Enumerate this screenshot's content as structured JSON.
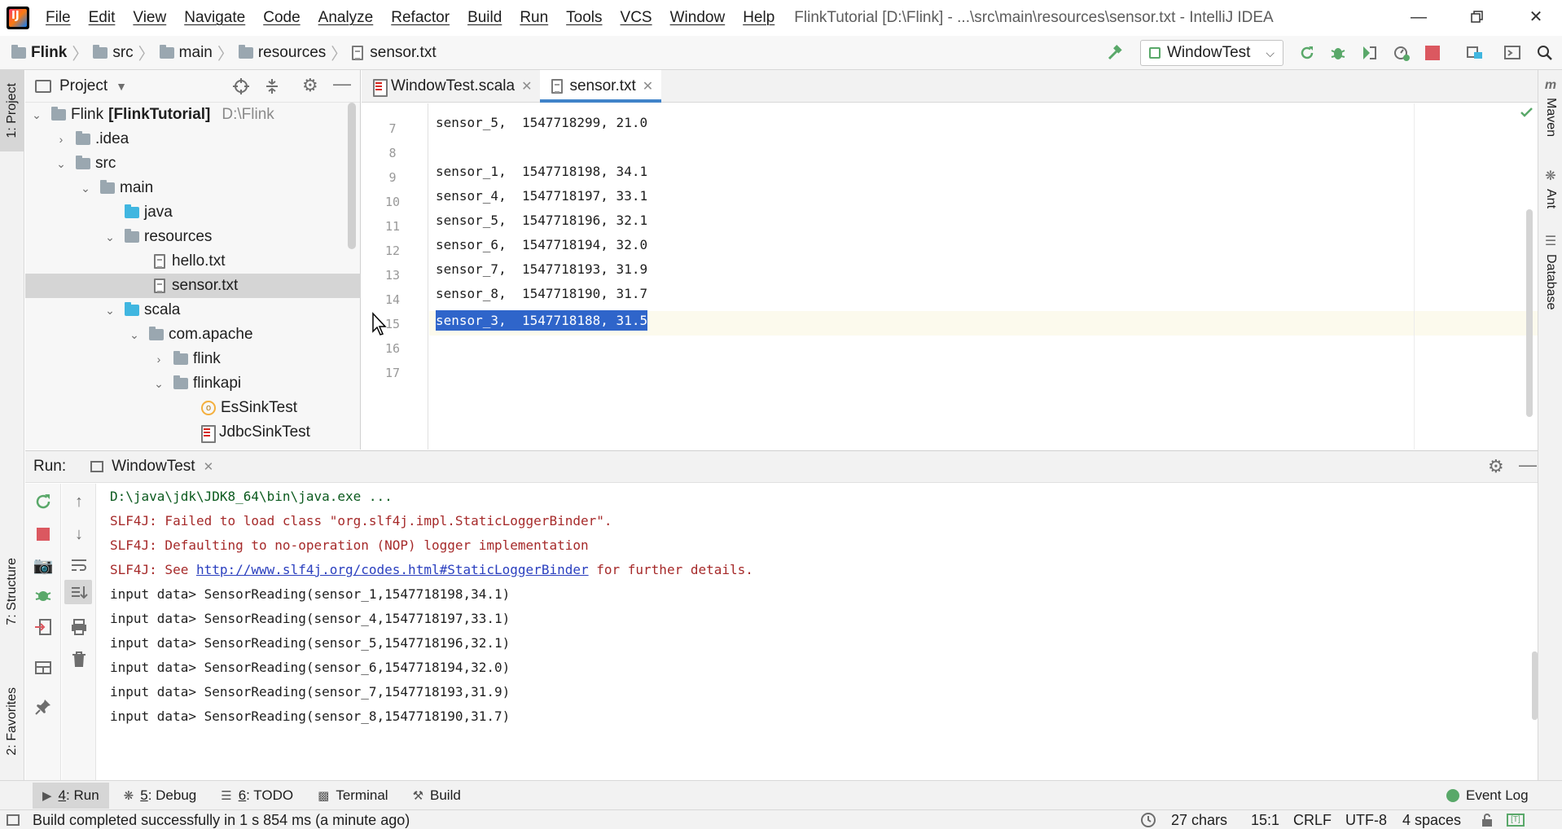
{
  "menubar": {
    "items": [
      "File",
      "Edit",
      "View",
      "Navigate",
      "Code",
      "Analyze",
      "Refactor",
      "Build",
      "Run",
      "Tools",
      "VCS",
      "Window",
      "Help"
    ],
    "title": "FlinkTutorial [D:\\Flink] - ...\\src\\main\\resources\\sensor.txt - IntelliJ IDEA"
  },
  "navbar": {
    "breadcrumbs": [
      "Flink",
      "src",
      "main",
      "resources",
      "sensor.txt"
    ],
    "run_config": "WindowTest"
  },
  "left_strip": {
    "project_tab": "1: Project",
    "structure_tab": "7: Structure",
    "favorites_tab": "2: Favorites"
  },
  "right_strip": {
    "maven": "Maven",
    "ant": "Ant",
    "database": "Database"
  },
  "project_panel": {
    "title": "Project",
    "tree": [
      {
        "label": "Flink",
        "bold_suffix": "[FlinkTutorial]",
        "path": "D:\\Flink"
      },
      {
        "label": ".idea"
      },
      {
        "label": "src"
      },
      {
        "label": "main"
      },
      {
        "label": "java"
      },
      {
        "label": "resources"
      },
      {
        "label": "hello.txt"
      },
      {
        "label": "sensor.txt"
      },
      {
        "label": "scala"
      },
      {
        "label": "com.apache"
      },
      {
        "label": "flink"
      },
      {
        "label": "flinkapi"
      },
      {
        "label": "EsSinkTest"
      },
      {
        "label": "JdbcSinkTest"
      }
    ]
  },
  "editor": {
    "tabs": [
      {
        "label": "WindowTest.scala"
      },
      {
        "label": "sensor.txt"
      }
    ],
    "lines": [
      {
        "n": "7",
        "text": "sensor_5,  1547718299, 21.0"
      },
      {
        "n": "8",
        "text": ""
      },
      {
        "n": "9",
        "text": "sensor_1,  1547718198, 34.1"
      },
      {
        "n": "10",
        "text": "sensor_4,  1547718197, 33.1"
      },
      {
        "n": "11",
        "text": "sensor_5,  1547718196, 32.1"
      },
      {
        "n": "12",
        "text": "sensor_6,  1547718194, 32.0"
      },
      {
        "n": "13",
        "text": "sensor_7,  1547718193, 31.9"
      },
      {
        "n": "14",
        "text": "sensor_8,  1547718190, 31.7"
      },
      {
        "n": "15",
        "text": "sensor_3,  1547718188, 31.5"
      },
      {
        "n": "16",
        "text": ""
      },
      {
        "n": "17",
        "text": ""
      }
    ]
  },
  "run_panel": {
    "label": "Run:",
    "tab": "WindowTest",
    "console": [
      {
        "kind": "cmd",
        "text": "D:\\java\\jdk\\JDK8_64\\bin\\java.exe ..."
      },
      {
        "kind": "err",
        "text": "SLF4J: Failed to load class \"org.slf4j.impl.StaticLoggerBinder\"."
      },
      {
        "kind": "err",
        "text": "SLF4J: Defaulting to no-operation (NOP) logger implementation"
      },
      {
        "kind": "link",
        "prefix": "SLF4J: See ",
        "link": "http://www.slf4j.org/codes.html#StaticLoggerBinder",
        "suffix": " for further details."
      },
      {
        "kind": "out",
        "text": "input data> SensorReading(sensor_1,1547718198,34.1)"
      },
      {
        "kind": "out",
        "text": "input data> SensorReading(sensor_4,1547718197,33.1)"
      },
      {
        "kind": "out",
        "text": "input data> SensorReading(sensor_5,1547718196,32.1)"
      },
      {
        "kind": "out",
        "text": "input data> SensorReading(sensor_6,1547718194,32.0)"
      },
      {
        "kind": "out",
        "text": "input data> SensorReading(sensor_7,1547718193,31.9)"
      },
      {
        "kind": "out",
        "text": "input data> SensorReading(sensor_8,1547718190,31.7)"
      }
    ]
  },
  "bottom_tabs": [
    {
      "num": "4",
      "label": ": Run"
    },
    {
      "num": "5",
      "label": ": Debug"
    },
    {
      "num": "6",
      "label": ": TODO"
    },
    {
      "num": "",
      "label": "Terminal"
    },
    {
      "num": "",
      "label": "Build"
    }
  ],
  "event_log": "Event Log",
  "status": {
    "message": "Build completed successfully in 1 s 854 ms (a minute ago)",
    "chars": "27 chars",
    "position": "15:1",
    "line_sep": "CRLF",
    "encoding": "UTF-8",
    "indent": "4 spaces"
  },
  "colors": {
    "accent": "#4083c9",
    "selection": "#2f65ca",
    "error_text": "#a62a2a",
    "link": "#2a3fbf"
  }
}
